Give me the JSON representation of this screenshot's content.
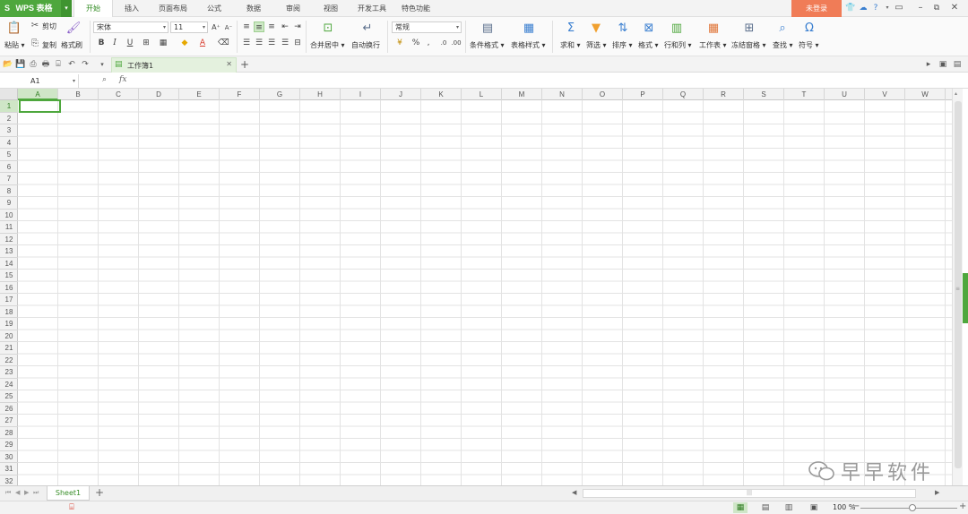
{
  "app": {
    "title": "WPS 表格",
    "login": "未登录"
  },
  "menu": {
    "tabs": [
      "开始",
      "插入",
      "页面布局",
      "公式",
      "数据",
      "审阅",
      "视图",
      "开发工具",
      "特色功能"
    ],
    "active": "开始"
  },
  "ribbon": {
    "paste": "粘贴",
    "cut": "剪切",
    "copy": "复制",
    "format_painter": "格式刷",
    "font_name": "宋体",
    "font_size": "11",
    "merge_center": "合并居中",
    "wrap_text": "自动换行",
    "number_format": "常规",
    "conditional_format": "条件格式",
    "table_style": "表格样式",
    "sum": "求和",
    "filter": "筛选",
    "sort": "排序",
    "format": "格式",
    "rows_cols": "行和列",
    "worksheet": "工作表",
    "freeze": "冻结窗格",
    "find": "查找",
    "symbol": "符号",
    "icons": {
      "bold": "B",
      "italic": "I",
      "underline": "U",
      "grow_font": "A⁺",
      "shrink_font": "A⁻",
      "percent": "%",
      "comma": ",",
      "font_color": "A"
    }
  },
  "document": {
    "tab_title": "工作簿1"
  },
  "formula_bar": {
    "cell_ref": "A1",
    "fx": "fx"
  },
  "grid": {
    "columns": [
      "A",
      "B",
      "C",
      "D",
      "E",
      "F",
      "G",
      "H",
      "I",
      "J",
      "K",
      "L",
      "M",
      "N",
      "O",
      "P",
      "Q",
      "R",
      "S",
      "T",
      "U",
      "V",
      "W"
    ],
    "rows": [
      "1",
      "2",
      "3",
      "4",
      "5",
      "6",
      "7",
      "8",
      "9",
      "10",
      "11",
      "12",
      "13",
      "14",
      "15",
      "16",
      "17",
      "18",
      "19",
      "20",
      "21",
      "22",
      "23",
      "24",
      "25",
      "26",
      "27",
      "28",
      "29",
      "30",
      "31",
      "32"
    ],
    "selected_cell": "A1"
  },
  "sheets": {
    "tabs": [
      "Sheet1"
    ],
    "active": "Sheet1"
  },
  "status": {
    "zoom": "100 %"
  },
  "watermark": {
    "text": "早早软件"
  },
  "colors": {
    "accent": "#4ea73d",
    "login_bg": "#f07c57",
    "selected_header": "#cfe6c7"
  }
}
